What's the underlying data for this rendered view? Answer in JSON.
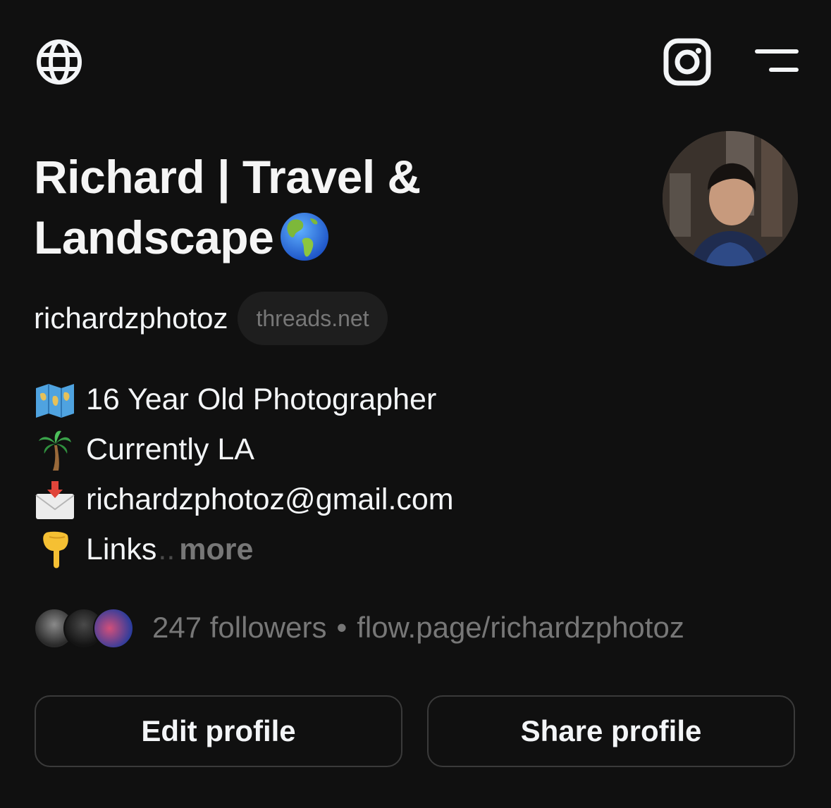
{
  "header": {
    "globe_icon": "globe-icon",
    "instagram_icon": "instagram-icon",
    "menu_icon": "menu-icon"
  },
  "profile": {
    "name_line1": "Richard | Travel &",
    "name_line2": "Landscape",
    "name_emoji": "globe-americas-emoji",
    "username": "richardzphotoz",
    "domain_badge": "threads.net"
  },
  "bio": {
    "lines": [
      {
        "emoji": "world-map-emoji",
        "text": "16 Year Old Photographer"
      },
      {
        "emoji": "palm-tree-emoji",
        "text": "Currently LA"
      },
      {
        "emoji": "envelope-arrow-emoji",
        "text": "richardzphotoz@gmail.com"
      },
      {
        "emoji": "pointing-down-emoji",
        "text": "Links"
      }
    ],
    "ellipsis": "..",
    "more_label": "more"
  },
  "meta": {
    "followers_text": "247 followers",
    "separator": "•",
    "link_text": "flow.page/richardzphotoz"
  },
  "actions": {
    "edit_label": "Edit profile",
    "share_label": "Share profile"
  },
  "colors": {
    "background": "#101010",
    "primary_text": "#f3f5f7",
    "secondary_text": "#777777",
    "pill_background": "#1e1e1e",
    "button_border": "#3a3a3a"
  }
}
